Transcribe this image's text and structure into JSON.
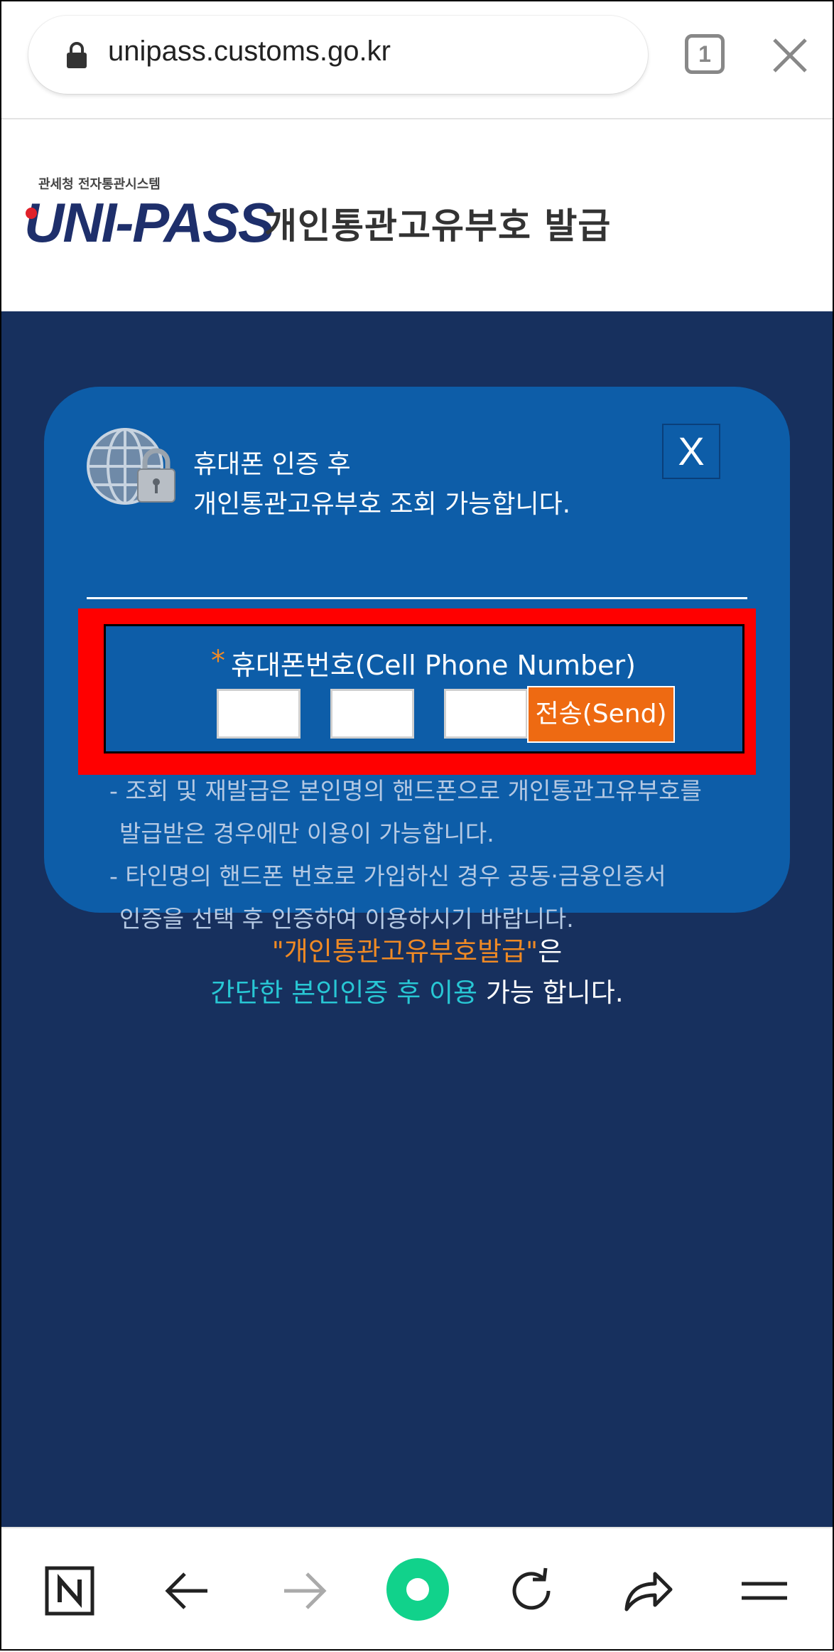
{
  "browser": {
    "url": "unipass.customs.go.kr",
    "tab_count": "1"
  },
  "header": {
    "logo_subtitle": "관세청 전자통관시스템",
    "logo_text": "UNI-PASS",
    "title": "개인통관고유부호 발급"
  },
  "modal": {
    "message_line1": "휴대폰 인증 후",
    "message_line2": "개인통관고유부호 조회 가능합니다.",
    "close_label": "X",
    "required_mark": "*",
    "phone_label": "휴대폰번호(Cell Phone Number)",
    "dash": "-",
    "send_label": "전송(Send)",
    "notes": [
      "- 조회 및 재발급은 본인명의 핸드폰으로 개인통관고유부호를",
      "발급받은 경우에만 이용이 가능합니다.",
      "- 타인명의 핸드폰 번호로 가입하신 경우 공동·금융인증서",
      "인증을 선택 후 인증하여 이용하시기 바랍니다."
    ]
  },
  "promo": {
    "line1_highlight": "\"개인통관고유부호발급\"",
    "line1_rest": "은",
    "line2_highlight": "간단한 본인인증 후 이용",
    "line2_rest": " 가능 합니다."
  },
  "toolbar": {
    "icons": [
      "naver-n-icon",
      "back-arrow-icon",
      "forward-arrow-icon",
      "home-green-circle-icon",
      "refresh-icon",
      "share-icon",
      "menu-icon"
    ]
  },
  "colors": {
    "main_bg": "#17305e",
    "modal_bg": "#0d5da8",
    "highlight": "#ff0000",
    "send_button": "#ee6a12",
    "accent_orange": "#f08a24",
    "accent_cyan": "#28c7d4"
  }
}
